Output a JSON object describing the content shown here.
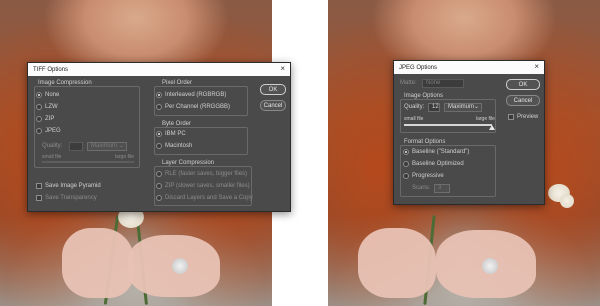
{
  "tiff": {
    "title": "TIFF Options",
    "image_compression": {
      "heading": "Image Compression",
      "options": [
        "None",
        "LZW",
        "ZIP",
        "JPEG"
      ],
      "selected": "None",
      "quality_label": "Quality:",
      "quality_select": "Maximum",
      "small_file": "small file",
      "large_file": "large file"
    },
    "pixel_order": {
      "heading": "Pixel Order",
      "options": [
        "Interleaved (RGBRGB)",
        "Per Channel (RRGGBB)"
      ],
      "selected": "Interleaved (RGBRGB)"
    },
    "byte_order": {
      "heading": "Byte Order",
      "options": [
        "IBM PC",
        "Macintosh"
      ],
      "selected": "IBM PC"
    },
    "layer_compression": {
      "heading": "Layer Compression",
      "options": [
        "RLE (faster saves, bigger files)",
        "ZIP (slower saves, smaller files)",
        "Discard Layers and Save a Copy"
      ]
    },
    "save_image_pyramid": "Save Image Pyramid",
    "save_transparency": "Save Transparency",
    "ok_label": "OK",
    "cancel_label": "Cancel"
  },
  "jpeg": {
    "title": "JPEG Options",
    "matte_label": "Matte:",
    "matte_value": "None",
    "image_options": {
      "heading": "Image Options",
      "quality_label": "Quality:",
      "quality_value": "12",
      "quality_select": "Maximum",
      "small_file": "small file",
      "large_file": "large file",
      "quality_fraction": 1.0
    },
    "format_options": {
      "heading": "Format Options",
      "options": [
        "Baseline (\"Standard\")",
        "Baseline Optimized",
        "Progressive"
      ],
      "selected": "Baseline (\"Standard\")",
      "scans_label": "Scans:",
      "scans_value": "3"
    },
    "ok_label": "OK",
    "cancel_label": "Cancel",
    "preview_label": "Preview"
  },
  "icons": {
    "close": "close-icon",
    "chevron": "chevron-down-icon"
  },
  "colors": {
    "dialog_bg": "#4a4a4a",
    "titlebar_bg": "#fcfcfc",
    "hair": "#b5491c"
  }
}
